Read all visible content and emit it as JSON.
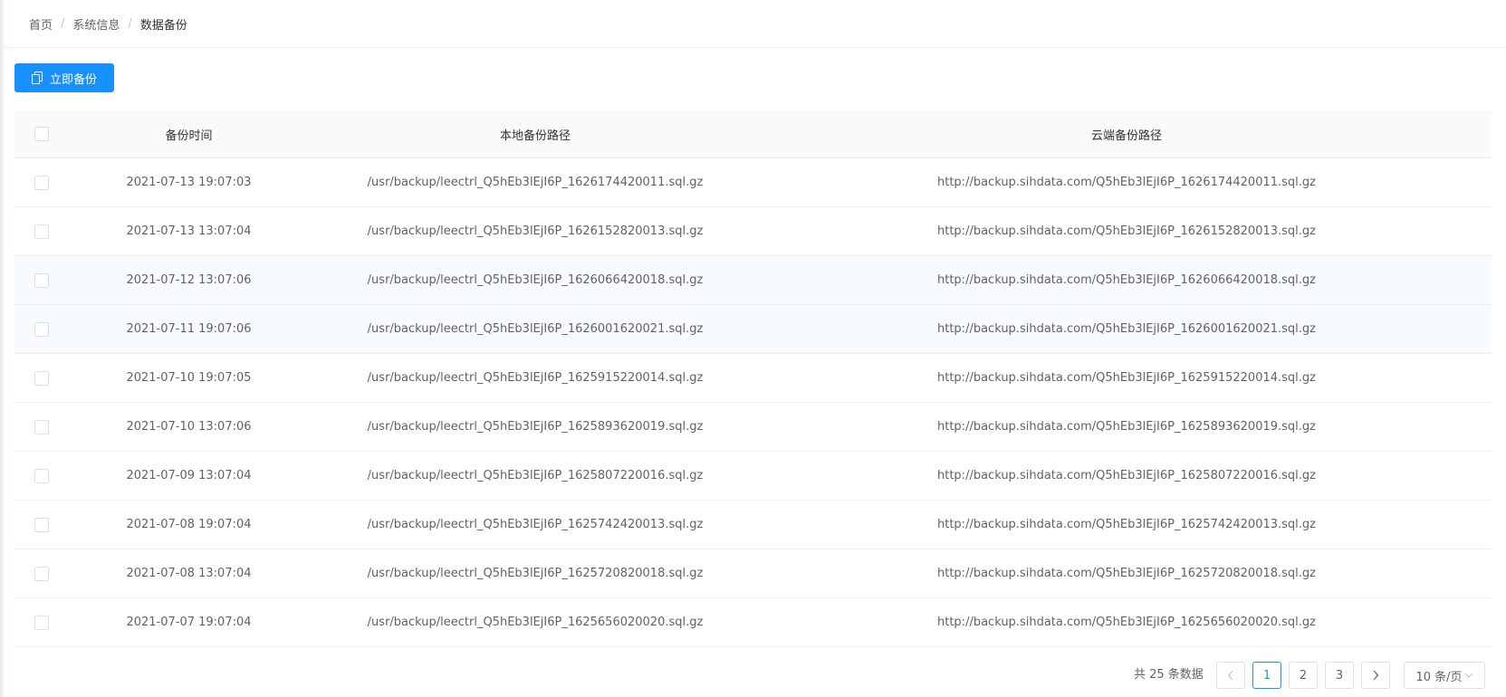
{
  "breadcrumb": {
    "items": [
      "首页",
      "系统信息",
      "数据备份"
    ],
    "separator": "/"
  },
  "toolbar": {
    "backup_label": "立即备份",
    "backup_icon": "copy-icon"
  },
  "table": {
    "headers": {
      "time": "备份时间",
      "local": "本地备份路径",
      "cloud": "云端备份路径"
    },
    "rows": [
      {
        "time": "2021-07-13 19:07:03",
        "local": "/usr/backup/leectrl_Q5hEb3lEjI6P_1626174420011.sql.gz",
        "cloud": "http://backup.sihdata.com/Q5hEb3lEjI6P_1626174420011.sql.gz"
      },
      {
        "time": "2021-07-13 13:07:04",
        "local": "/usr/backup/leectrl_Q5hEb3lEjI6P_1626152820013.sql.gz",
        "cloud": "http://backup.sihdata.com/Q5hEb3lEjI6P_1626152820013.sql.gz"
      },
      {
        "time": "2021-07-12 13:07:06",
        "local": "/usr/backup/leectrl_Q5hEb3lEjI6P_1626066420018.sql.gz",
        "cloud": "http://backup.sihdata.com/Q5hEb3lEjI6P_1626066420018.sql.gz"
      },
      {
        "time": "2021-07-11 19:07:06",
        "local": "/usr/backup/leectrl_Q5hEb3lEjI6P_1626001620021.sql.gz",
        "cloud": "http://backup.sihdata.com/Q5hEb3lEjI6P_1626001620021.sql.gz"
      },
      {
        "time": "2021-07-10 19:07:05",
        "local": "/usr/backup/leectrl_Q5hEb3lEjI6P_1625915220014.sql.gz",
        "cloud": "http://backup.sihdata.com/Q5hEb3lEjI6P_1625915220014.sql.gz"
      },
      {
        "time": "2021-07-10 13:07:06",
        "local": "/usr/backup/leectrl_Q5hEb3lEjI6P_1625893620019.sql.gz",
        "cloud": "http://backup.sihdata.com/Q5hEb3lEjI6P_1625893620019.sql.gz"
      },
      {
        "time": "2021-07-09 13:07:04",
        "local": "/usr/backup/leectrl_Q5hEb3lEjI6P_1625807220016.sql.gz",
        "cloud": "http://backup.sihdata.com/Q5hEb3lEjI6P_1625807220016.sql.gz"
      },
      {
        "time": "2021-07-08 19:07:04",
        "local": "/usr/backup/leectrl_Q5hEb3lEjI6P_1625742420013.sql.gz",
        "cloud": "http://backup.sihdata.com/Q5hEb3lEjI6P_1625742420013.sql.gz"
      },
      {
        "time": "2021-07-08 13:07:04",
        "local": "/usr/backup/leectrl_Q5hEb3lEjI6P_1625720820018.sql.gz",
        "cloud": "http://backup.sihdata.com/Q5hEb3lEjI6P_1625720820018.sql.gz"
      },
      {
        "time": "2021-07-07 19:07:04",
        "local": "/usr/backup/leectrl_Q5hEb3lEjI6P_1625656020020.sql.gz",
        "cloud": "http://backup.sihdata.com/Q5hEb3lEjI6P_1625656020020.sql.gz"
      }
    ]
  },
  "pagination": {
    "total_text": "共 25 条数据",
    "pages": [
      "1",
      "2",
      "3"
    ],
    "current_page": "1",
    "page_size_label": "10 条/页",
    "prev_icon": "chevron-left-icon",
    "next_icon": "chevron-right-icon"
  },
  "colors": {
    "primary": "#1890ff",
    "border": "#ebeef5",
    "header_bg": "#fafafa",
    "hover_row_bg": "#f8fbfd"
  }
}
